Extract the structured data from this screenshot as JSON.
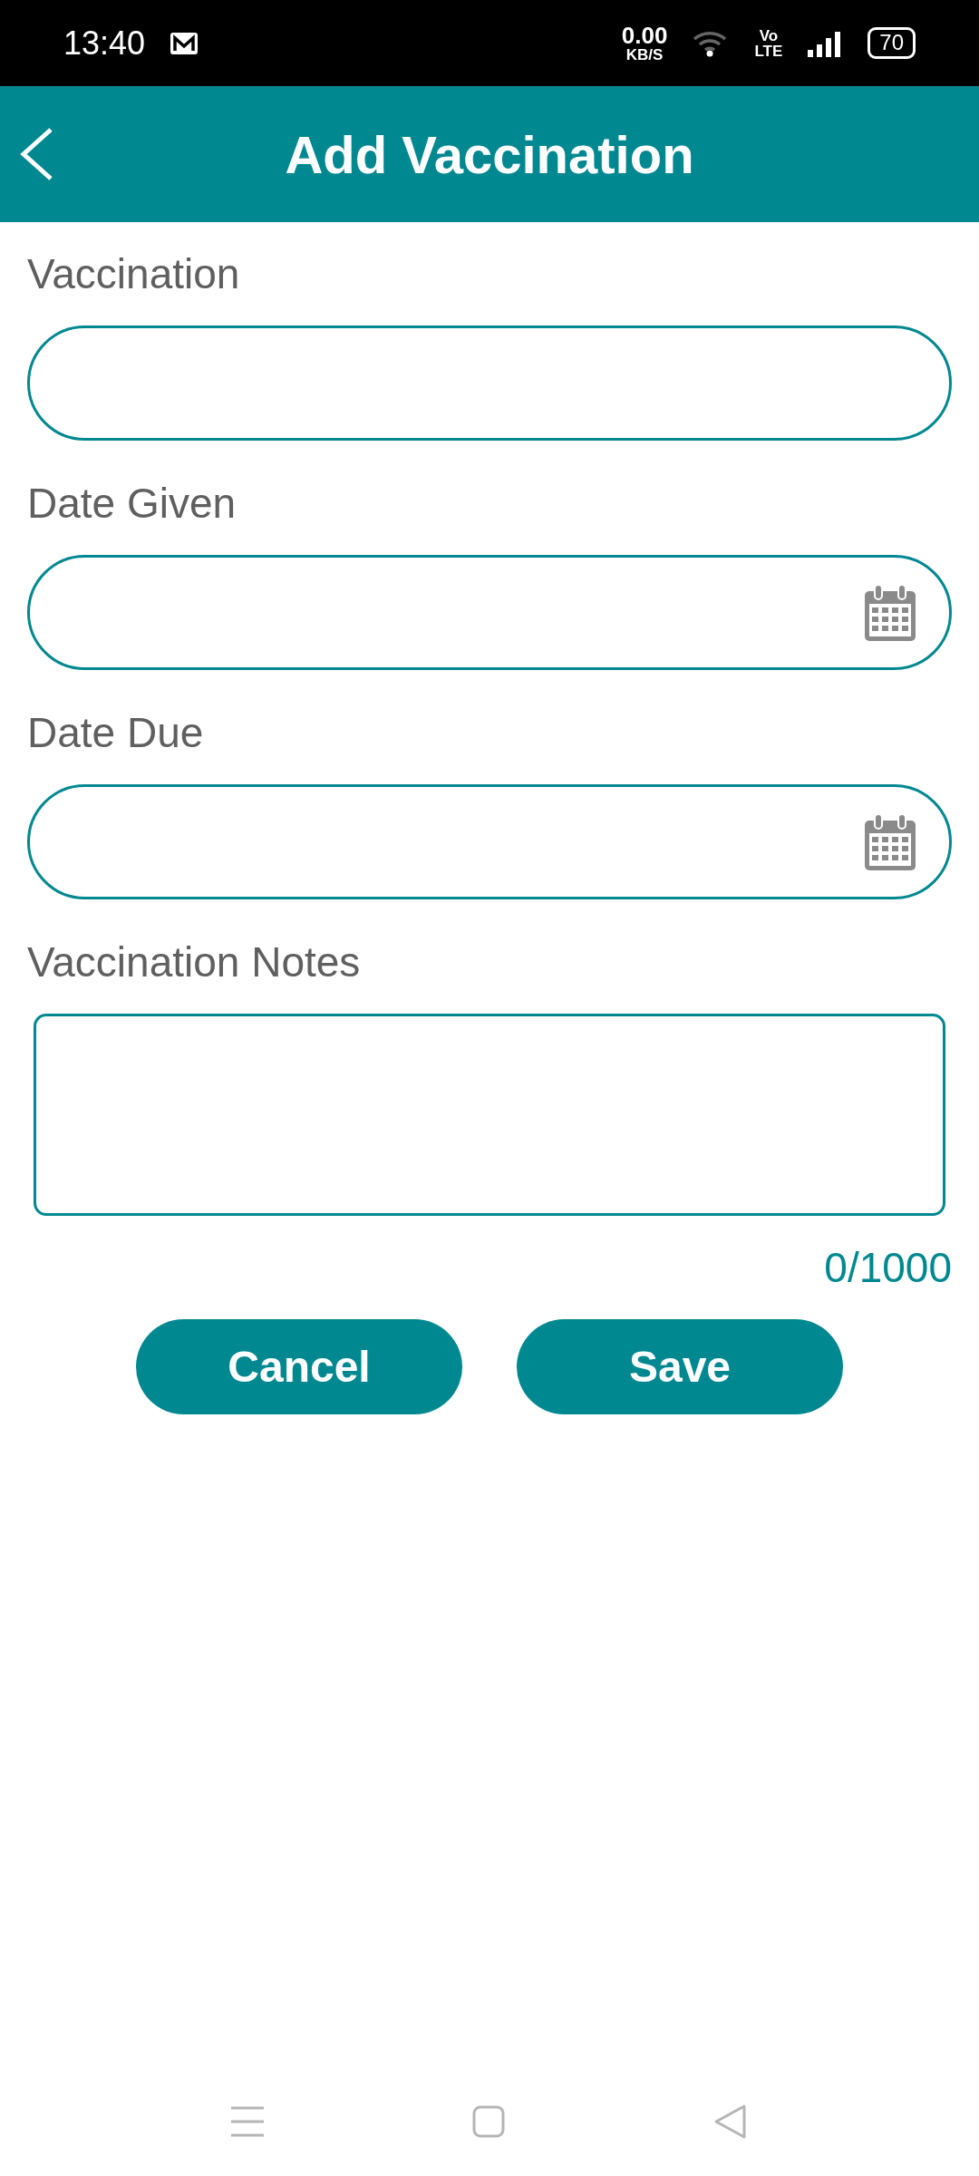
{
  "status_bar": {
    "time": "13:40",
    "speed_value": "0.00",
    "speed_unit": "KB/S",
    "volte_top": "Vo",
    "volte_bottom": "LTE",
    "battery": "70"
  },
  "header": {
    "title": "Add Vaccination"
  },
  "fields": [
    {
      "label": "Vaccination",
      "kind": "text"
    },
    {
      "label": "Date Given",
      "kind": "date"
    },
    {
      "label": "Date Due",
      "kind": "date"
    }
  ],
  "notes": {
    "label": "Vaccination Notes",
    "counter": "0/1000"
  },
  "buttons": [
    "Cancel",
    "Save"
  ]
}
